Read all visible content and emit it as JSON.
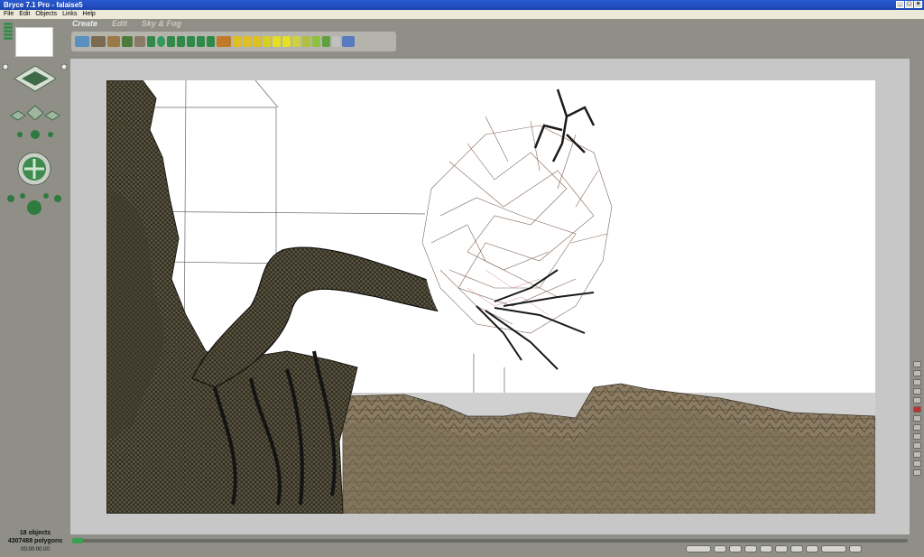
{
  "window": {
    "title": "Bryce 7.1  Pro - falaise5",
    "controls": [
      "_",
      "□",
      "×"
    ]
  },
  "menu": [
    "File",
    "Edit",
    "Objects",
    "Links",
    "Help"
  ],
  "palette_tabs": [
    {
      "label": "Create",
      "active": true
    },
    {
      "label": "Edit",
      "active": false
    },
    {
      "label": "Sky & Fog",
      "active": false
    }
  ],
  "toolbar_icons": [
    "water-plane-icon",
    "infinite-plane-icon",
    "terrain-icon",
    "tree-icon",
    "rock-icon",
    "symmetrical-lattice-icon",
    "sphere-icon",
    "torus-icon",
    "cube-icon",
    "cone-icon",
    "pyramid-icon",
    "disc-icon",
    "figure-icon",
    "radial-light-icon",
    "spotlight-icon",
    "square-light-icon",
    "parallel-light-icon",
    "camera-icon"
  ],
  "status": {
    "objects": "18 objects",
    "polygons": "4307488 polygons",
    "time": "00:00:00.00"
  },
  "colors": {
    "app_bg": "#8f8f88",
    "viewport_border": "#c7c7c7",
    "accent_green": "#3da04e"
  }
}
